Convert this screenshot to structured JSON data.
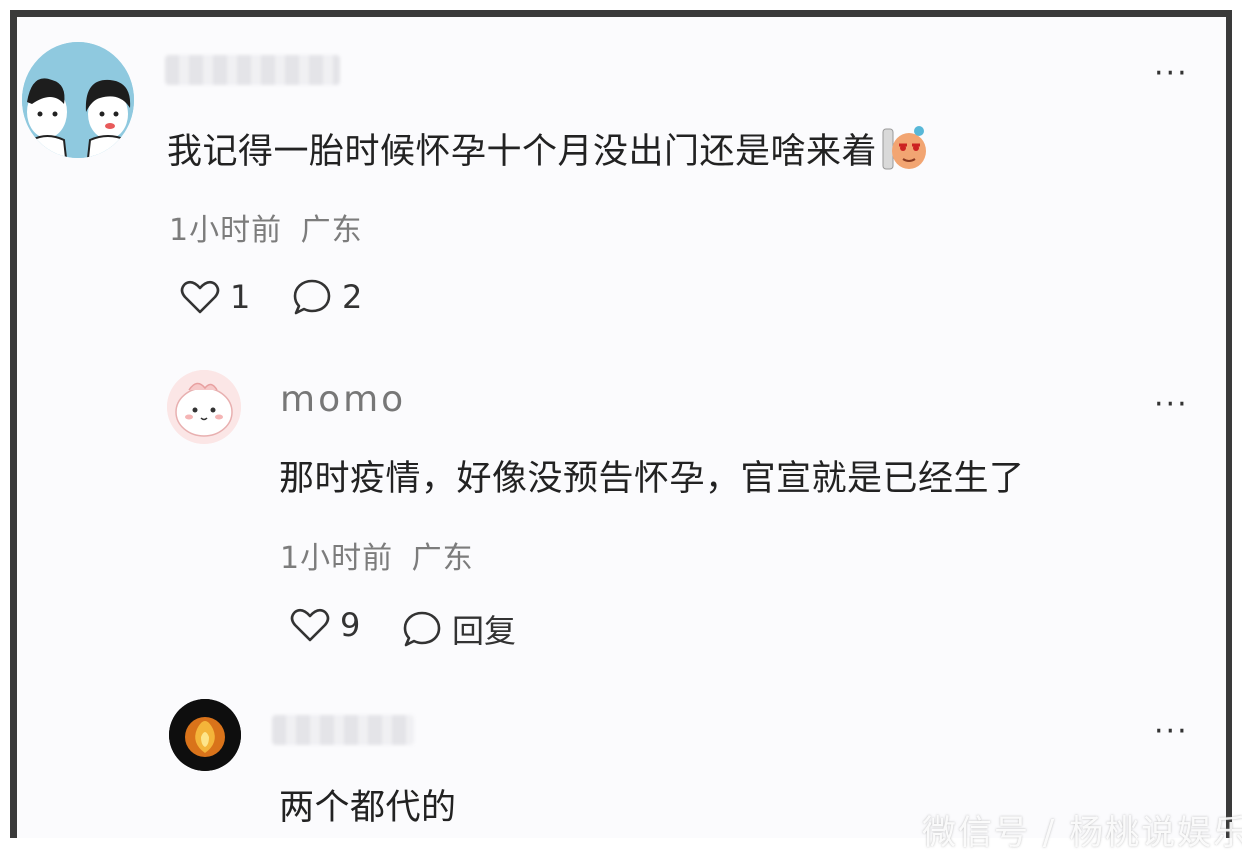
{
  "comments": [
    {
      "username": "",
      "text": "我记得一胎时候怀孕十个月没出门还是啥来着",
      "emoji": "doge-sticker",
      "time": "1小时前",
      "location": "广东",
      "likes": "1",
      "replies": "2",
      "more": "···"
    },
    {
      "username": "momo",
      "text": "那时疫情，好像没预告怀孕，官宣就是已经生了",
      "time": "1小时前",
      "location": "广东",
      "likes": "9",
      "reply_label": "回复",
      "more": "···"
    },
    {
      "username": "",
      "text": "两个都代的",
      "more": "···"
    }
  ],
  "watermark": "微信号 / 杨桃说娱乐",
  "colors": {
    "frame": "#3a3a3a",
    "background": "#fbfbfd",
    "text": "#222222",
    "meta": "#7c7c7c",
    "avatar1_bg": "#8fc9df"
  }
}
